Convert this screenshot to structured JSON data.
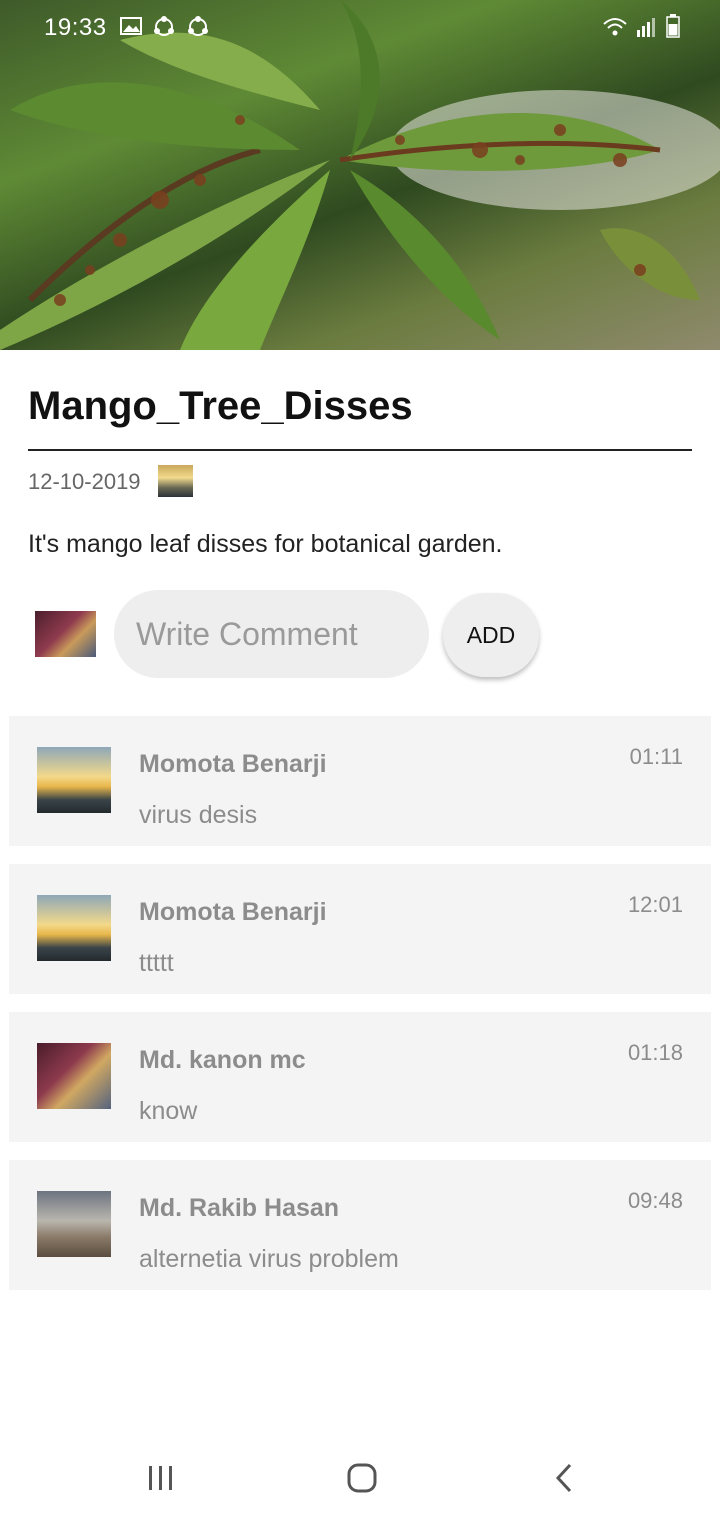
{
  "status_bar": {
    "time": "19:33"
  },
  "post": {
    "title": "Mango_Tree_Disses",
    "date": "12-10-2019",
    "description": "It's mango leaf disses for botanical garden."
  },
  "comment_box": {
    "placeholder": "Write Comment",
    "add_label": "ADD"
  },
  "comments": [
    {
      "name": "Momota Benarji",
      "text": "virus desis",
      "time": "01:11"
    },
    {
      "name": "Momota Benarji",
      "text": "ttttt",
      "time": "12:01"
    },
    {
      "name": "Md. kanon mc",
      "text": "know",
      "time": "01:18"
    },
    {
      "name": "Md. Rakib Hasan",
      "text": "alternetia virus problem",
      "time": "09:48"
    }
  ],
  "colors": {
    "comment_bg": "#f4f4f4",
    "muted_text": "#8c8c8c",
    "input_bg": "#eeeeee"
  }
}
